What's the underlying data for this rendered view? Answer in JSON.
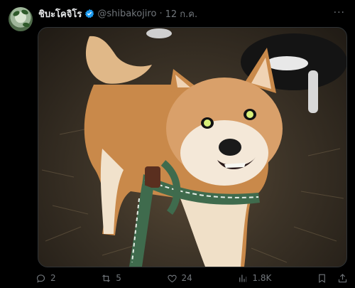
{
  "tweet": {
    "author_name": "ชิบะโคจิโร",
    "handle": "@shibakojiro",
    "dot": "·",
    "date": "12 ก.ค.",
    "more_label": "···"
  },
  "actions": {
    "reply_count": "2",
    "repost_count": "5",
    "like_count": "24",
    "views_count": "1.8K"
  },
  "colors": {
    "background": "#000000",
    "muted": "#71767b",
    "verified": "#1d9bf0"
  }
}
